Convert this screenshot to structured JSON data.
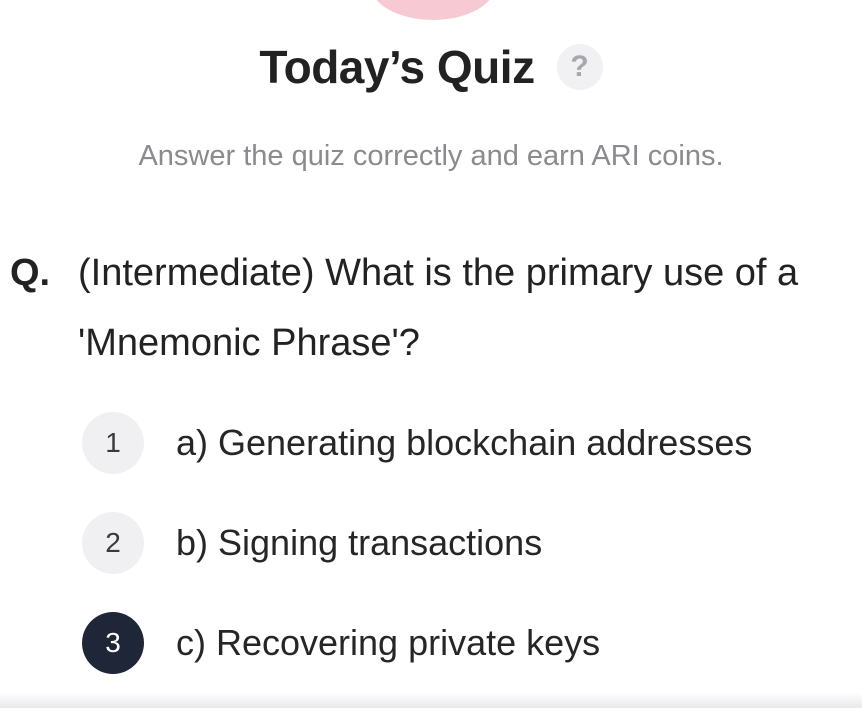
{
  "header": {
    "title": "Today’s Quiz",
    "help_icon": "question-mark-icon",
    "help_symbol": "?"
  },
  "subtitle": "Answer the quiz correctly and earn ARI coins.",
  "question": {
    "prefix": "Q.",
    "text": "(Intermediate) What is the primary use of a 'Mnemonic Phrase'?"
  },
  "options": [
    {
      "number": "1",
      "label": "a) Generating blockchain addresses",
      "selected": false
    },
    {
      "number": "2",
      "label": "b) Signing transactions",
      "selected": false
    },
    {
      "number": "3",
      "label": "c) Recovering private keys",
      "selected": true
    }
  ],
  "colors": {
    "accent_pink": "#f6c9d3",
    "selected_badge": "#1f2638",
    "badge_bg": "#f0f0f2",
    "subtitle_gray": "#8a8a8f"
  }
}
